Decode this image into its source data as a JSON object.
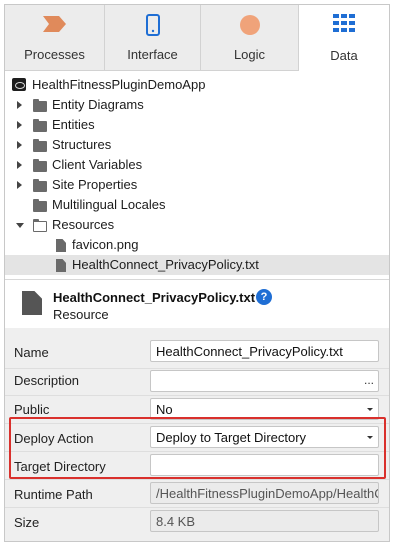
{
  "tabs": [
    {
      "label": "Processes",
      "icon": "processes-icon"
    },
    {
      "label": "Interface",
      "icon": "interface-icon"
    },
    {
      "label": "Logic",
      "icon": "logic-icon"
    },
    {
      "label": "Data",
      "icon": "data-grid-icon"
    }
  ],
  "active_tab": "Data",
  "tree": {
    "root": "HealthFitnessPluginDemoApp",
    "items": [
      {
        "label": "Entity Diagrams"
      },
      {
        "label": "Entities"
      },
      {
        "label": "Structures"
      },
      {
        "label": "Client Variables"
      },
      {
        "label": "Site Properties"
      },
      {
        "label": "Multilingual Locales"
      },
      {
        "label": "Resources"
      },
      {
        "label": "favicon.png"
      },
      {
        "label": "HealthConnect_PrivacyPolicy.txt"
      }
    ]
  },
  "details": {
    "title": "HealthConnect_PrivacyPolicy.txt",
    "help": "?",
    "subtitle": "Resource"
  },
  "properties": {
    "name_label": "Name",
    "name_value": "HealthConnect_PrivacyPolicy.txt",
    "description_label": "Description",
    "description_value": "",
    "description_more": "...",
    "public_label": "Public",
    "public_value": "No",
    "deploy_action_label": "Deploy Action",
    "deploy_action_value": "Deploy to Target Directory",
    "target_directory_label": "Target Directory",
    "target_directory_value": "",
    "runtime_path_label": "Runtime Path",
    "runtime_path_value": "/HealthFitnessPluginDemoApp/HealthC",
    "size_label": "Size",
    "size_value": "8.4 KB"
  },
  "colors": {
    "accent": "#1f6ed4",
    "process_icon": "#e08a5b",
    "logic_icon": "#f0a37a",
    "data_icon": "#1f6ed4",
    "highlight": "#d9302c"
  }
}
